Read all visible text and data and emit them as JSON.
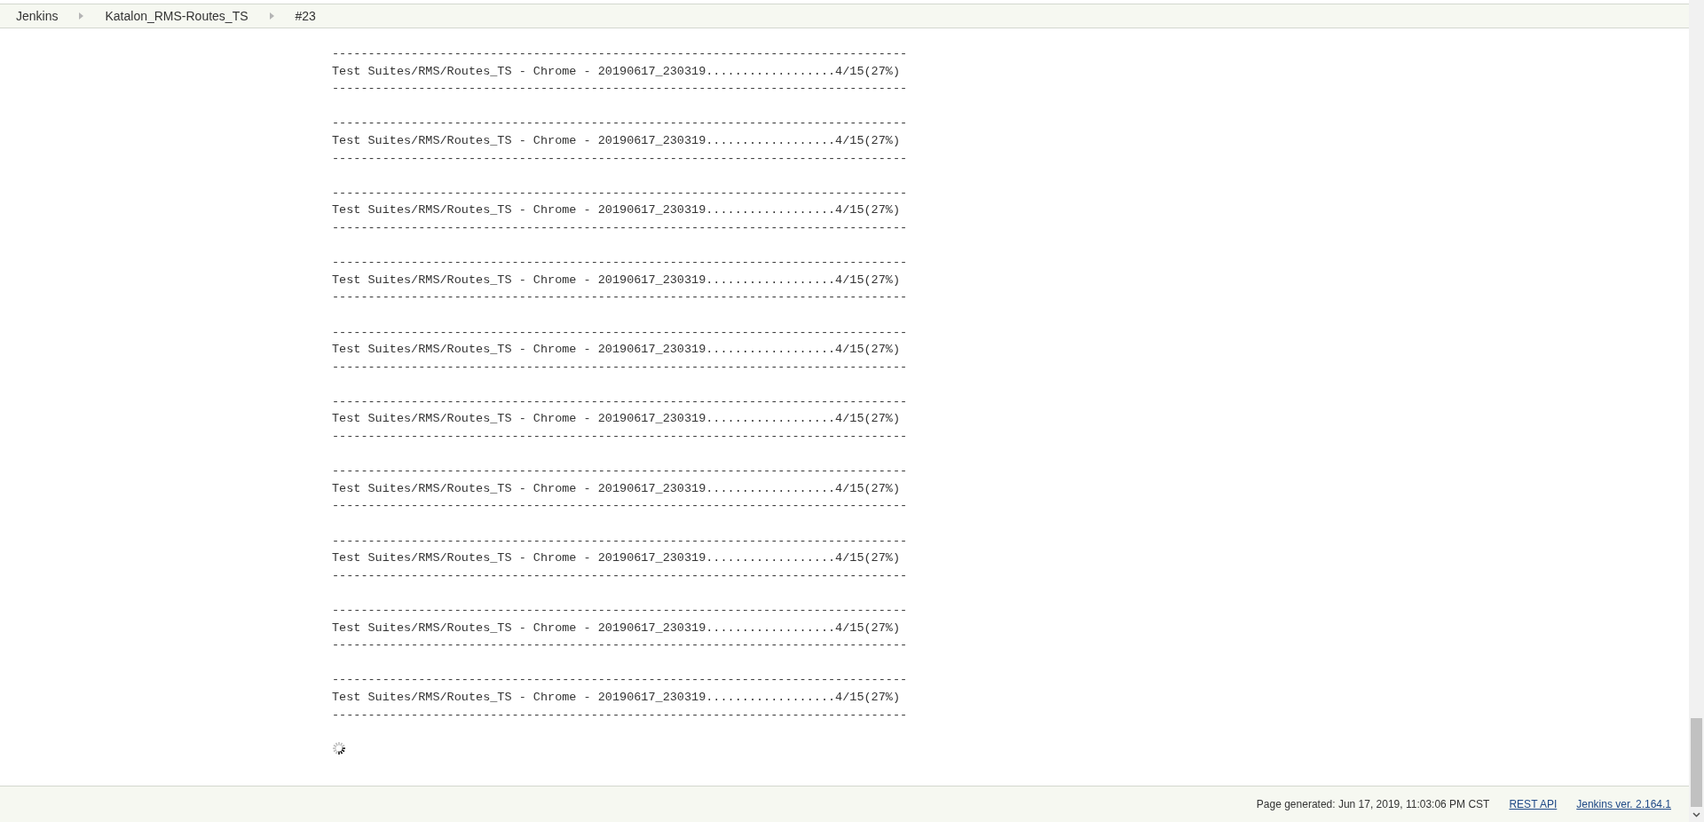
{
  "breadcrumbs": [
    "Jenkins",
    "Katalon_RMS-Routes_TS",
    "#23"
  ],
  "console": {
    "blocks": [
      {
        "rule_top": "--------------------------------------------------------------------------------",
        "text": "Test Suites/RMS/Routes_TS - Chrome - 20190617_230319..................4/15(27%)",
        "rule_bottom": "--------------------------------------------------------------------------------"
      },
      {
        "rule_top": "--------------------------------------------------------------------------------",
        "text": "Test Suites/RMS/Routes_TS - Chrome - 20190617_230319..................4/15(27%)",
        "rule_bottom": "--------------------------------------------------------------------------------"
      },
      {
        "rule_top": "--------------------------------------------------------------------------------",
        "text": "Test Suites/RMS/Routes_TS - Chrome - 20190617_230319..................4/15(27%)",
        "rule_bottom": "--------------------------------------------------------------------------------"
      },
      {
        "rule_top": "--------------------------------------------------------------------------------",
        "text": "Test Suites/RMS/Routes_TS - Chrome - 20190617_230319..................4/15(27%)",
        "rule_bottom": "--------------------------------------------------------------------------------"
      },
      {
        "rule_top": "--------------------------------------------------------------------------------",
        "text": "Test Suites/RMS/Routes_TS - Chrome - 20190617_230319..................4/15(27%)",
        "rule_bottom": "--------------------------------------------------------------------------------"
      },
      {
        "rule_top": "--------------------------------------------------------------------------------",
        "text": "Test Suites/RMS/Routes_TS - Chrome - 20190617_230319..................4/15(27%)",
        "rule_bottom": "--------------------------------------------------------------------------------"
      },
      {
        "rule_top": "--------------------------------------------------------------------------------",
        "text": "Test Suites/RMS/Routes_TS - Chrome - 20190617_230319..................4/15(27%)",
        "rule_bottom": "--------------------------------------------------------------------------------"
      },
      {
        "rule_top": "--------------------------------------------------------------------------------",
        "text": "Test Suites/RMS/Routes_TS - Chrome - 20190617_230319..................4/15(27%)",
        "rule_bottom": "--------------------------------------------------------------------------------"
      },
      {
        "rule_top": "--------------------------------------------------------------------------------",
        "text": "Test Suites/RMS/Routes_TS - Chrome - 20190617_230319..................4/15(27%)",
        "rule_bottom": "--------------------------------------------------------------------------------"
      },
      {
        "rule_top": "--------------------------------------------------------------------------------",
        "text": "Test Suites/RMS/Routes_TS - Chrome - 20190617_230319..................4/15(27%)",
        "rule_bottom": "--------------------------------------------------------------------------------"
      }
    ]
  },
  "footer": {
    "generated": "Page generated: Jun 17, 2019, 11:03:06 PM CST",
    "links": [
      "REST API",
      "Jenkins ver. 2.164.1"
    ]
  }
}
